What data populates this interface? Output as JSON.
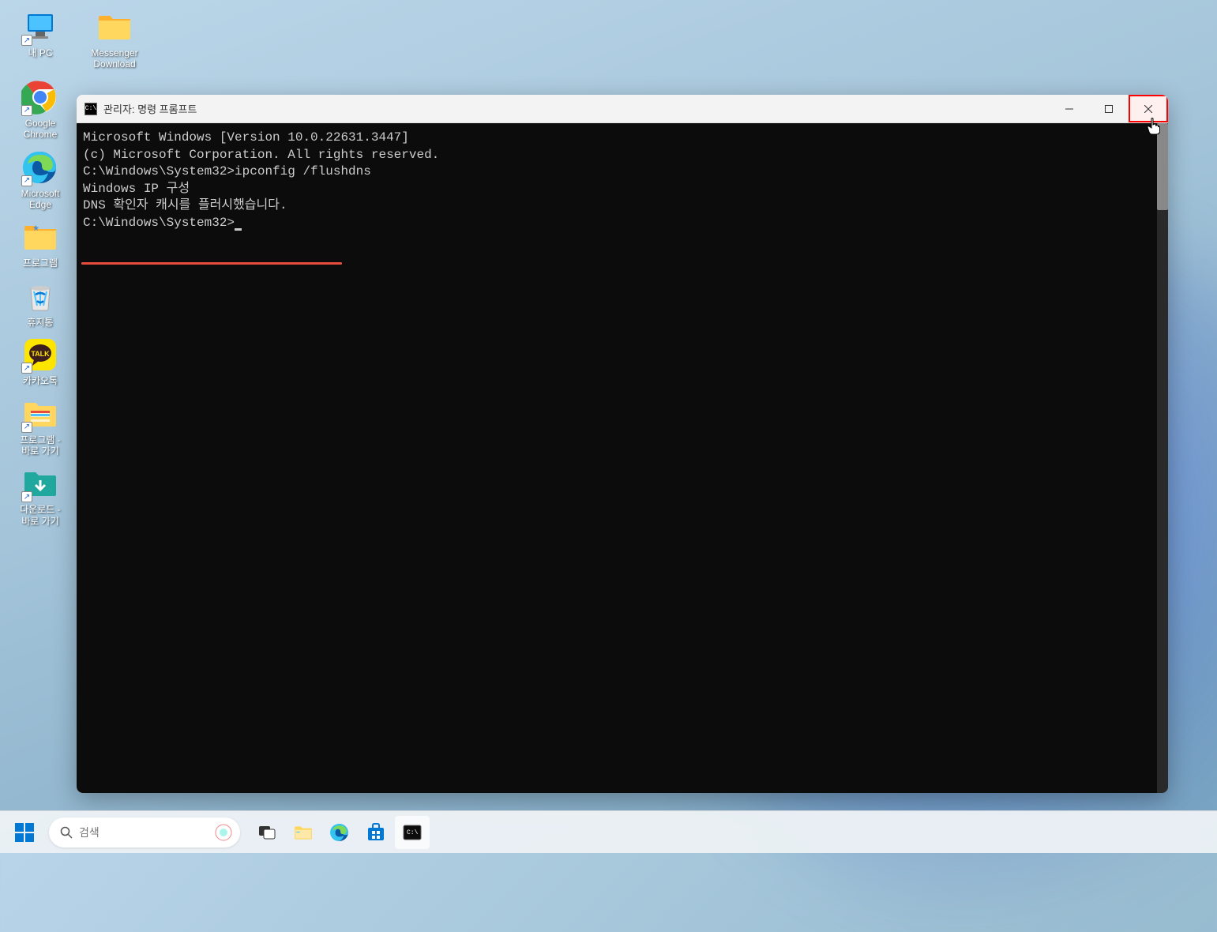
{
  "desktop": {
    "icons": [
      {
        "label": "내 PC",
        "type": "this-pc"
      },
      {
        "label": "Messenger\nDownload",
        "type": "folder"
      },
      {
        "label": "Google\nChrome",
        "type": "chrome"
      },
      {
        "label": "Microsoft\nEdge",
        "type": "edge"
      },
      {
        "label": "프로그램",
        "type": "folder-star"
      },
      {
        "label": "휴지통",
        "type": "recycle-bin"
      },
      {
        "label": "카카오톡",
        "type": "kakao"
      },
      {
        "label": "프로그램 -\n바로 가기",
        "type": "folder-shortcut"
      },
      {
        "label": "다운로드 -\n바로 가기",
        "type": "downloads-shortcut"
      }
    ]
  },
  "cmd": {
    "title": "관리자: 명령 프롬프트",
    "lines": {
      "l1": "Microsoft Windows [Version 10.0.22631.3447]",
      "l2": "(c) Microsoft Corporation. All rights reserved.",
      "l3": "",
      "l4": "C:\\Windows\\System32>ipconfig /flushdns",
      "l5": "",
      "l6": "Windows IP 구성",
      "l7": "",
      "l8": "DNS 확인자 캐시를 플러시했습니다.",
      "l9": "",
      "l10": "C:\\Windows\\System32>"
    }
  },
  "taskbar": {
    "search_placeholder": "검색"
  }
}
